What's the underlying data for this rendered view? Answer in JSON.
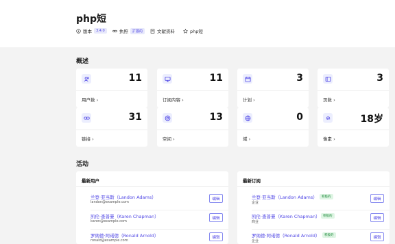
{
  "header": {
    "title": "php短",
    "meta": [
      {
        "icon": "info-icon",
        "label": "版本",
        "badge": "3.4.0"
      },
      {
        "icon": "link-icon",
        "label": "执照",
        "badge": "扩展的"
      },
      {
        "icon": "document-icon",
        "label": "文献资料",
        "badge": ""
      },
      {
        "icon": "star-icon",
        "label": "php短",
        "badge": ""
      }
    ]
  },
  "overview": {
    "title": "概述",
    "cards": [
      {
        "icon": "users-icon",
        "value": "11",
        "label": "用户数 ›"
      },
      {
        "icon": "monitor-icon",
        "value": "11",
        "label": "订阅内容 ›"
      },
      {
        "icon": "calendar-icon",
        "value": "3",
        "label": "计划 ›"
      },
      {
        "icon": "page-icon",
        "value": "3",
        "label": "页数 ›"
      },
      {
        "icon": "link-icon",
        "value": "31",
        "label": "链接 ›"
      },
      {
        "icon": "target-icon",
        "value": "13",
        "label": "空间 ›"
      },
      {
        "icon": "globe-icon",
        "value": "0",
        "label": "域 ›"
      },
      {
        "icon": "fingerprint-icon",
        "value": "18岁",
        "label": "像素 ›"
      }
    ]
  },
  "activity": {
    "title": "活动",
    "latest_users": {
      "title": "最新用户",
      "rows": [
        {
          "name": "兰登·亚当斯（Landon Adams）",
          "sub": "landon@example.com",
          "button": "编辑"
        },
        {
          "name": "凯伦·查普曼（Karen Chapman）",
          "sub": "karen@example.com",
          "button": "编辑"
        },
        {
          "name": "罗纳德·阿诺德（Ronald Arnold）",
          "sub": "ronald@example.com",
          "button": "编辑"
        }
      ]
    },
    "latest_subscriptions": {
      "title": "最新订阅",
      "rows": [
        {
          "name": "兰登·亚当斯（Landon Adams）",
          "tag": "积极的",
          "sub": "企业",
          "button": "编辑"
        },
        {
          "name": "凯伦·查普曼（Karen Chapman）",
          "tag": "积极的",
          "sub": "商业",
          "button": "编辑"
        },
        {
          "name": "罗纳德·阿诺德（Ronald Arnold）",
          "tag": "积极的",
          "sub": "企业",
          "button": "编辑"
        }
      ]
    }
  },
  "colors": {
    "accent": "#4f46e5",
    "background": "#f3f3f3",
    "active_tag": "#1f8a3c"
  }
}
